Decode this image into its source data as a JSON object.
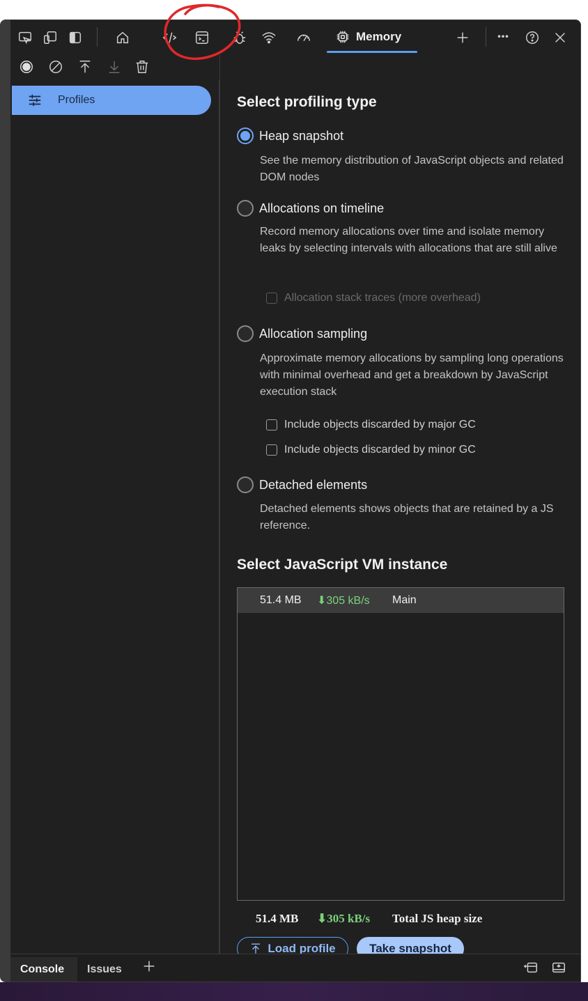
{
  "toolbar": {
    "tabs": [
      {
        "icon": "cast-icon"
      },
      {
        "icon": "device-emulation-icon"
      },
      {
        "icon": "dock-side-icon"
      },
      {
        "icon": "home-icon"
      },
      {
        "icon": "elements-icon"
      },
      {
        "icon": "console-icon"
      },
      {
        "icon": "sources-bug-icon"
      },
      {
        "icon": "network-wifi-icon"
      },
      {
        "icon": "performance-gauge-icon"
      }
    ],
    "active_tab_label": "Memory",
    "active_tab_icon": "memory-chip-icon",
    "more_tabs_icon": "plus-icon",
    "overflow_icon": "more-icon",
    "help_icon": "help-icon",
    "close_icon": "close-icon",
    "accent_color": "#5b9df0"
  },
  "toolbar2": {
    "icons": [
      "record-icon",
      "clear-icon",
      "load-icon",
      "save-icon",
      "garbage-collect-icon"
    ]
  },
  "sidebar": {
    "items": [
      {
        "label": "Profiles",
        "icon": "profiles-sliders-icon",
        "selected": true
      }
    ]
  },
  "main": {
    "profiling_heading": "Select profiling type",
    "options": [
      {
        "label": "Heap snapshot",
        "checked": true,
        "description": "See the memory distribution of JavaScript objects and related DOM nodes"
      },
      {
        "label": "Allocations on timeline",
        "checked": false,
        "description": "Record memory allocations over time and isolate memory leaks by selecting intervals with allocations that are still alive",
        "checkboxes": [
          {
            "label": "Allocation stack traces (more overhead)",
            "checked": false,
            "disabled": true
          }
        ]
      },
      {
        "label": "Allocation sampling",
        "checked": false,
        "description": "Approximate memory allocations by sampling long operations with minimal overhead and get a breakdown by JavaScript execution stack",
        "checkboxes": [
          {
            "label": "Include objects discarded by major GC",
            "checked": false,
            "disabled": false
          },
          {
            "label": "Include objects discarded by minor GC",
            "checked": false,
            "disabled": false
          }
        ]
      },
      {
        "label": "Detached elements",
        "checked": false,
        "description": "Detached elements shows objects that are retained by a JS reference."
      }
    ],
    "vm_heading": "Select JavaScript VM instance",
    "vm_instances": [
      {
        "size": "51.4 MB",
        "rate": "⬇305 kB/s",
        "name": "Main"
      }
    ],
    "summary": {
      "size": "51.4 MB",
      "rate": "⬇305 kB/s",
      "label": "Total JS heap size"
    },
    "load_button": "Load profile",
    "take_button": "Take snapshot"
  },
  "drawer": {
    "tabs": [
      {
        "label": "Console",
        "active": true
      },
      {
        "label": "Issues",
        "active": false
      }
    ],
    "add_icon": "plus-icon",
    "right_icons": [
      "dock-drawer-icon",
      "quick-view-icon"
    ]
  }
}
